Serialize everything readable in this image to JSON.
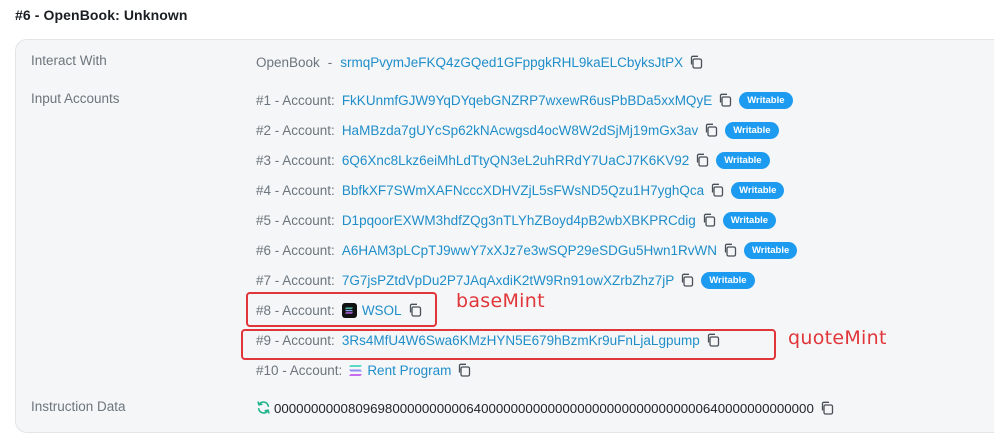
{
  "instruction": {
    "title": "#6 - OpenBook: Unknown"
  },
  "labels": {
    "interact_with": "Interact With",
    "input_accounts": "Input Accounts",
    "instruction_data": "Instruction Data"
  },
  "interact": {
    "program_name": "OpenBook",
    "separator": "-",
    "address": "srmqPvymJeFKQ4zGQed1GFppgkRHL9kaELCbyksJtPX"
  },
  "accounts": [
    {
      "prefix": "#1 - Account:",
      "value": "FkKUnmfGJW9YqDYqebGNZRP7wxewR6usPbBDa5xxMQyE",
      "badge": "Writable"
    },
    {
      "prefix": "#2 - Account:",
      "value": "HaMBzda7gUYcSp62kNAcwgsd4ocW8W2dSjMj19mGx3av",
      "badge": "Writable"
    },
    {
      "prefix": "#3 - Account:",
      "value": "6Q6Xnc8Lkz6eiMhLdTtyQN3eL2uhRRdY7UaCJ7K6KV92",
      "badge": "Writable"
    },
    {
      "prefix": "#4 - Account:",
      "value": "BbfkXF7SWmXAFNcccXDHVZjL5sFWsND5Qzu1H7yghQca",
      "badge": "Writable"
    },
    {
      "prefix": "#5 - Account:",
      "value": "D1pqoorEXWM3hdfZQg3nTLYhZBoyd4pB2wbXBKPRCdig",
      "badge": "Writable"
    },
    {
      "prefix": "#6 - Account:",
      "value": "A6HAM3pLCpTJ9wwY7xXJz7e3wSQP29eSDGu5Hwn1RvWN",
      "badge": "Writable"
    },
    {
      "prefix": "#7 - Account:",
      "value": "7G7jsPZtdVpDu2P7JAqAxdiK2tW9Rn91owXZrbZhz7jP",
      "badge": "Writable"
    },
    {
      "prefix": "#8 - Account:",
      "value": "WSOL",
      "icon": "solana-token-icon"
    },
    {
      "prefix": "#9 - Account:",
      "value": "3Rs4MfU4W6Swa6KMzHYN5E679hBzmKr9uFnLjaLgpump"
    },
    {
      "prefix": "#10 - Account:",
      "value": "Rent Program",
      "icon": "solana-program-icon"
    }
  ],
  "instruction_data": {
    "icon": "refresh-icon",
    "value": "0000000000809698000000000064000000000000000000000000000000640000000000000"
  },
  "annotations": {
    "base_mint": "baseMint",
    "quote_mint": "quoteMint"
  },
  "colors": {
    "link": "#1f8ec9",
    "badge": "#1d9bf0",
    "annotation": "#e0363a",
    "card_bg": "#f5f6f8"
  }
}
